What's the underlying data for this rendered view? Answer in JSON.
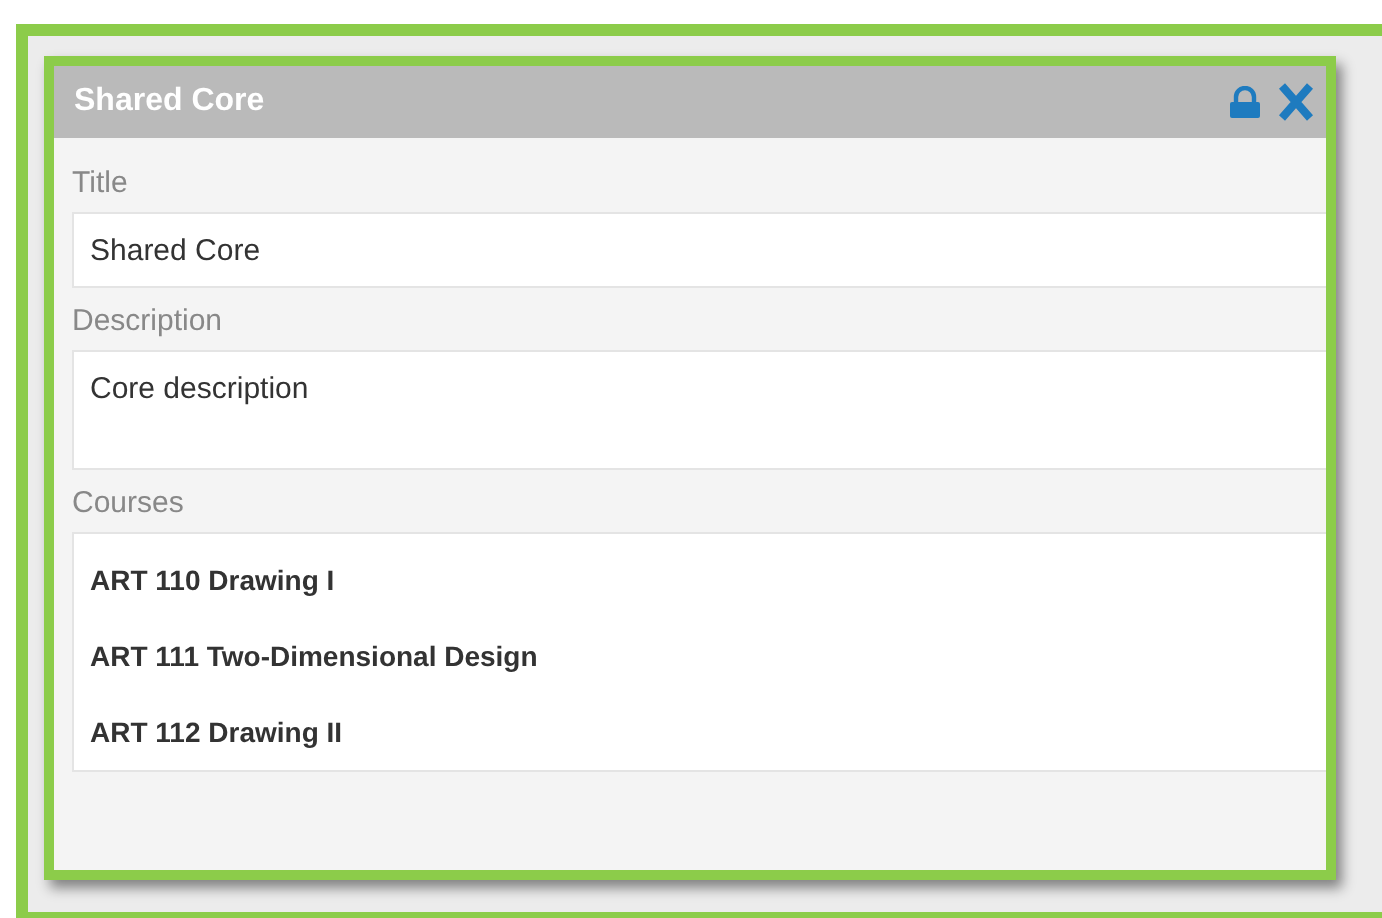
{
  "dialog": {
    "title": "Shared Core"
  },
  "fields": [
    {
      "label": "Title",
      "value": "Shared Core",
      "kind": "input"
    },
    {
      "label": "Description",
      "value": "Core description",
      "kind": "textarea"
    }
  ],
  "courses": {
    "label": "Courses",
    "items": [
      "ART 110 Drawing I",
      "ART 111 Two-Dimensional Design",
      "ART 112 Drawing II"
    ]
  }
}
